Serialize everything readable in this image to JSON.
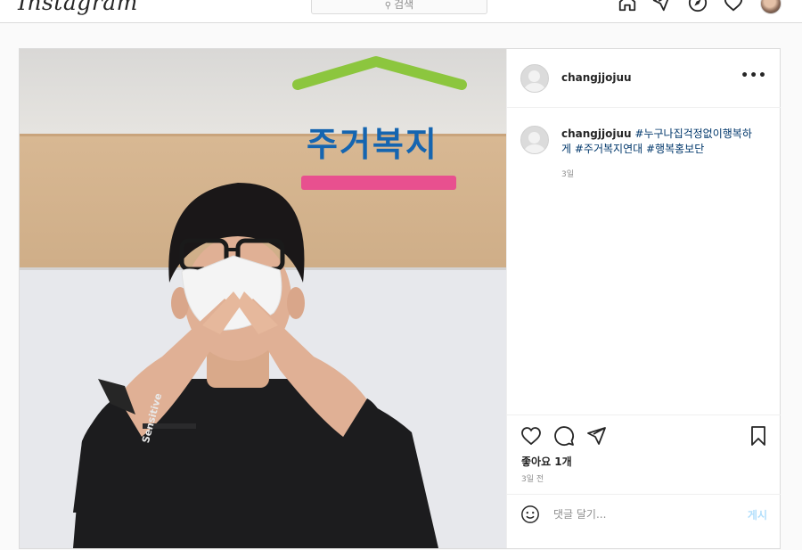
{
  "app": {
    "logo_text": "Instagram",
    "search_placeholder": "검색"
  },
  "nav": {
    "icons": [
      "home-icon",
      "direct-icon",
      "explore-icon",
      "activity-heart-icon"
    ],
    "profile": "profile-avatar"
  },
  "post": {
    "username": "changjjojuu",
    "more_icon": "more-options-icon",
    "image": {
      "sign_text": "주거복지",
      "shirt_text": "Sensitive"
    },
    "caption": {
      "username": "changjjojuu",
      "text_parts": [
        " ",
        "#누구나집걱정없이행복하게",
        " ",
        "#주거복지연대",
        " ",
        "#행복홍보단"
      ],
      "hashtags": [
        "#누구나집걱정없이행복하게",
        "#주거복지연대",
        "#행복홍보단"
      ],
      "time": "3일"
    },
    "actions": [
      "like-heart-icon",
      "comment-icon",
      "share-icon",
      "save-bookmark-icon"
    ],
    "likes": "좋아요 1개",
    "time": "3일 전",
    "comment": {
      "placeholder": "댓글 달기...",
      "post_label": "게시"
    }
  },
  "colors": {
    "sign_green": "#8cc63e",
    "sign_blue": "#1565b0",
    "sign_pink": "#e8508f",
    "link_hashtag": "#00376b",
    "post_button_disabled": "#b2dffc"
  }
}
